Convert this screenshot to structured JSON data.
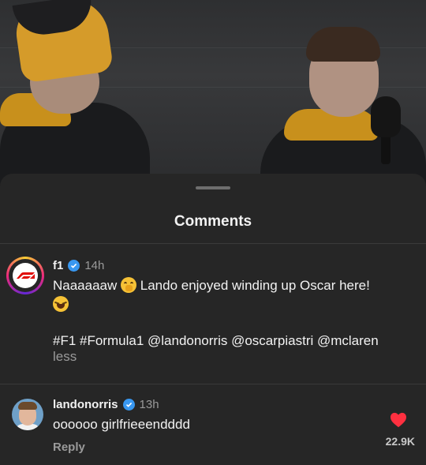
{
  "sheet": {
    "title": "Comments"
  },
  "comments": [
    {
      "username": "f1",
      "time": "14h",
      "text_part1": "Naaaaaaw",
      "text_part2": "Lando enjoyed winding up Oscar here!",
      "emoji1": "shushing-face-emoji",
      "emoji2": "laughing-face-emoji",
      "hashtags": "#F1 #Formula1 @landonorris @oscarpiastri @mclaren",
      "toggle_label": "less"
    },
    {
      "username": "landonorris",
      "time": "13h",
      "text": "oooooo girlfrieeendddd",
      "reply_label": "Reply",
      "like_count": "22.9K"
    }
  ],
  "colors": {
    "sheet_bg": "#262626",
    "verified": "#3897f0",
    "heart": "#ff3040",
    "f1_red": "#e10600"
  }
}
